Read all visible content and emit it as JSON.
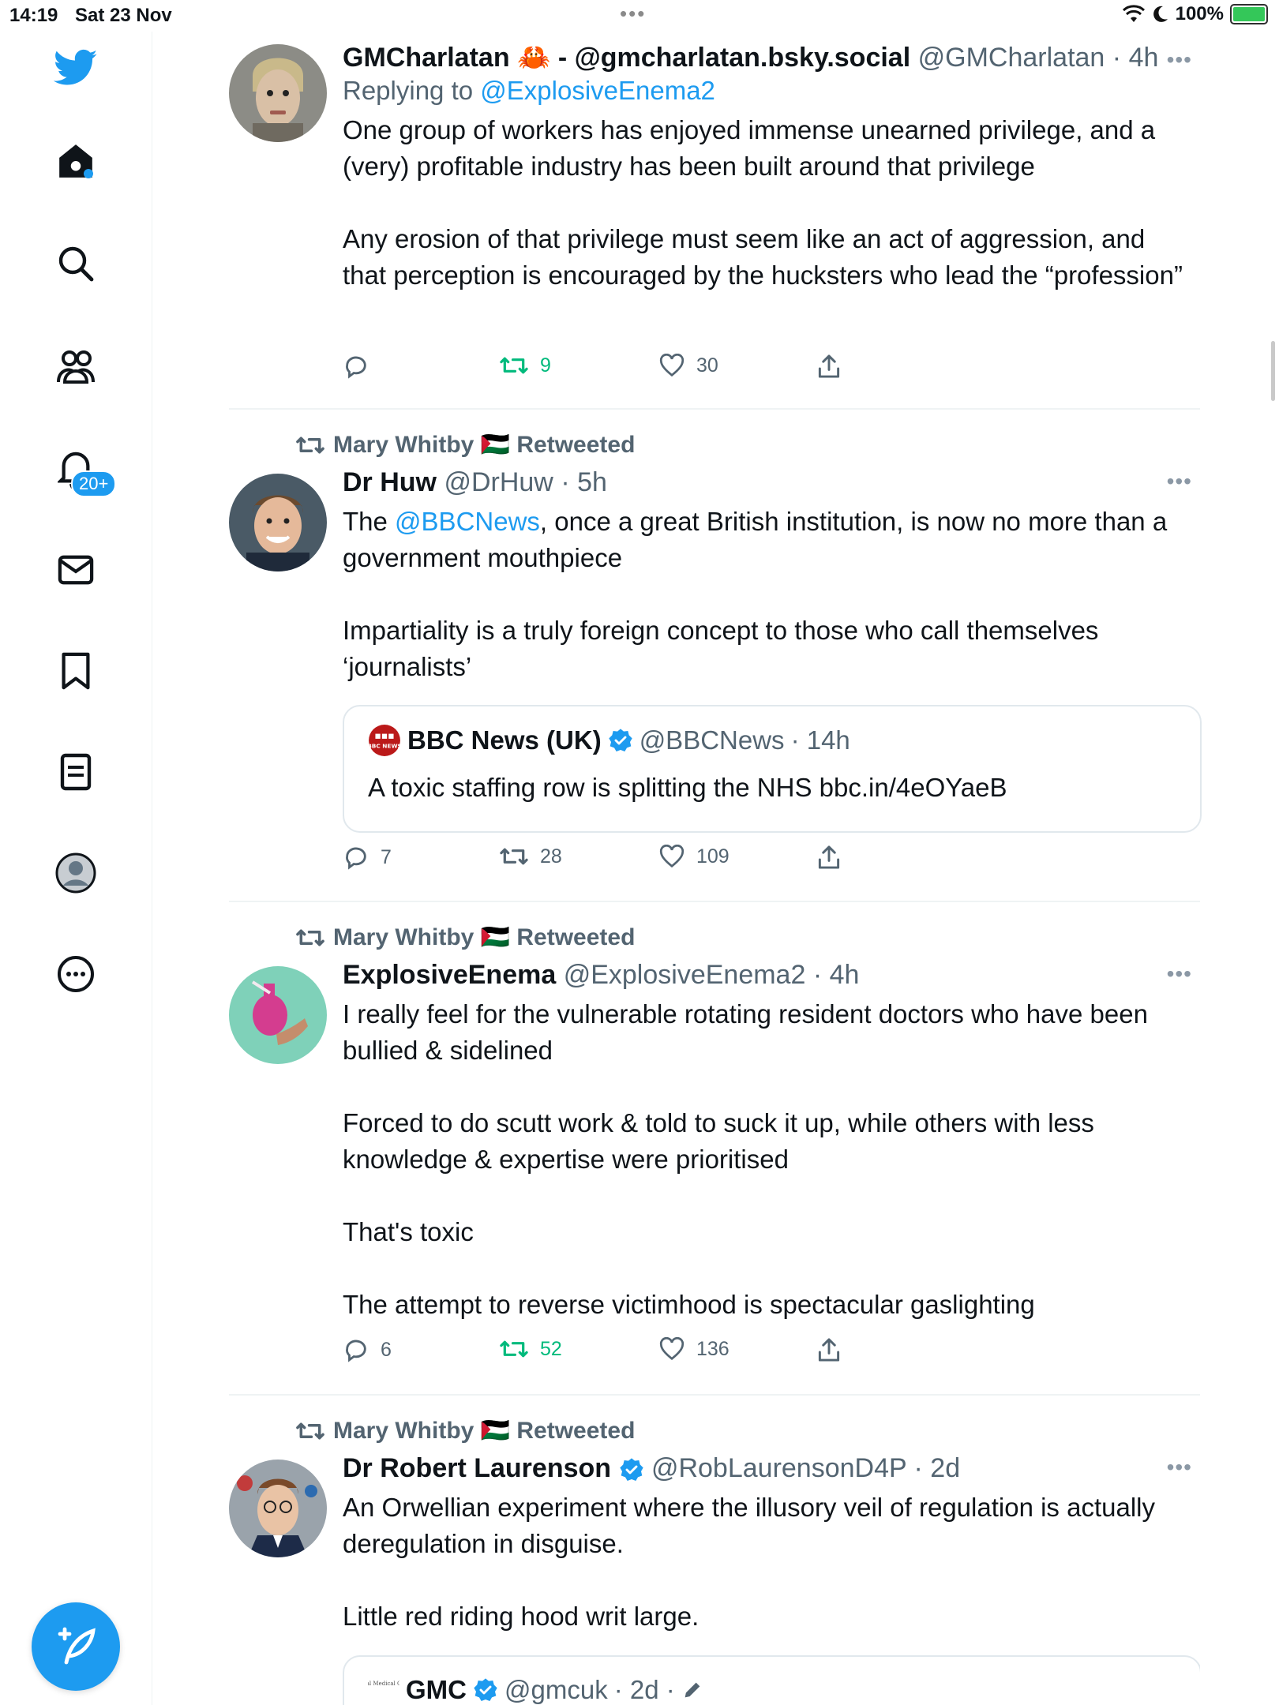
{
  "status_bar": {
    "time": "14:19",
    "date": "Sat 23 Nov",
    "battery": "100%"
  },
  "sidebar": {
    "notifications_badge": "20+"
  },
  "tweets": [
    {
      "display_name": "GMCharlatan 🦀 - @gmcharlatan.bsky.social",
      "handle": "@GMCharlatan",
      "time": "· 4h",
      "replying_prefix": "Replying to ",
      "replying_to": "@ExplosiveEnema2",
      "paragraphs": [
        "One group of workers has enjoyed immense unearned privilege, and a (very) profitable industry has been built around that privilege",
        "Any erosion of that privilege must seem like an act of aggression, and that perception is encouraged by the hucksters who lead the “profession”"
      ],
      "replies": "",
      "retweets": "9",
      "likes": "30"
    },
    {
      "retweeted_by": "Mary Whitby 🇵🇸 Retweeted",
      "display_name": "Dr Huw",
      "handle": "@DrHuw",
      "time": "· 5h",
      "text_before_link": "The ",
      "link": "@BBCNews",
      "text_after_link": ", once a great British institution, is now no more than a government mouthpiece",
      "paragraph2": "Impartiality is a truly foreign concept to those who call themselves ‘journalists’",
      "quote": {
        "logo": "BBC NEWS",
        "name": "BBC News (UK)",
        "handle": "@BBCNews",
        "time": "· 14h",
        "text": "A toxic staffing row is splitting the NHS bbc.in/4eOYaeB"
      },
      "replies": "7",
      "retweets": "28",
      "likes": "109"
    },
    {
      "retweeted_by": "Mary Whitby 🇵🇸 Retweeted",
      "display_name": "ExplosiveEnema",
      "handle": "@ExplosiveEnema2",
      "time": "· 4h",
      "paragraphs": [
        "I really feel for the vulnerable rotating resident doctors who have been bullied & sidelined",
        "Forced to do scutt work & told to suck it up, while others with less knowledge & expertise were prioritised",
        "That's toxic",
        "The attempt to reverse victimhood is spectacular gaslighting"
      ],
      "replies": "6",
      "retweets": "52",
      "likes": "136"
    },
    {
      "retweeted_by": "Mary Whitby 🇵🇸 Retweeted",
      "display_name": "Dr Robert Laurenson",
      "handle": "@RobLaurensonD4P",
      "time": "· 2d",
      "paragraphs": [
        "An Orwellian experiment where the illusory veil of regulation is actually deregulation in disguise.",
        "Little red riding hood writ large."
      ],
      "quote": {
        "logo": "General Medical Council",
        "name": "GMC",
        "handle": "@gmcuk",
        "time": "· 2d ·"
      }
    }
  ],
  "colors": {
    "accent": "#1d9bf0",
    "retweet_green": "#00ba7c",
    "muted": "#536471"
  }
}
